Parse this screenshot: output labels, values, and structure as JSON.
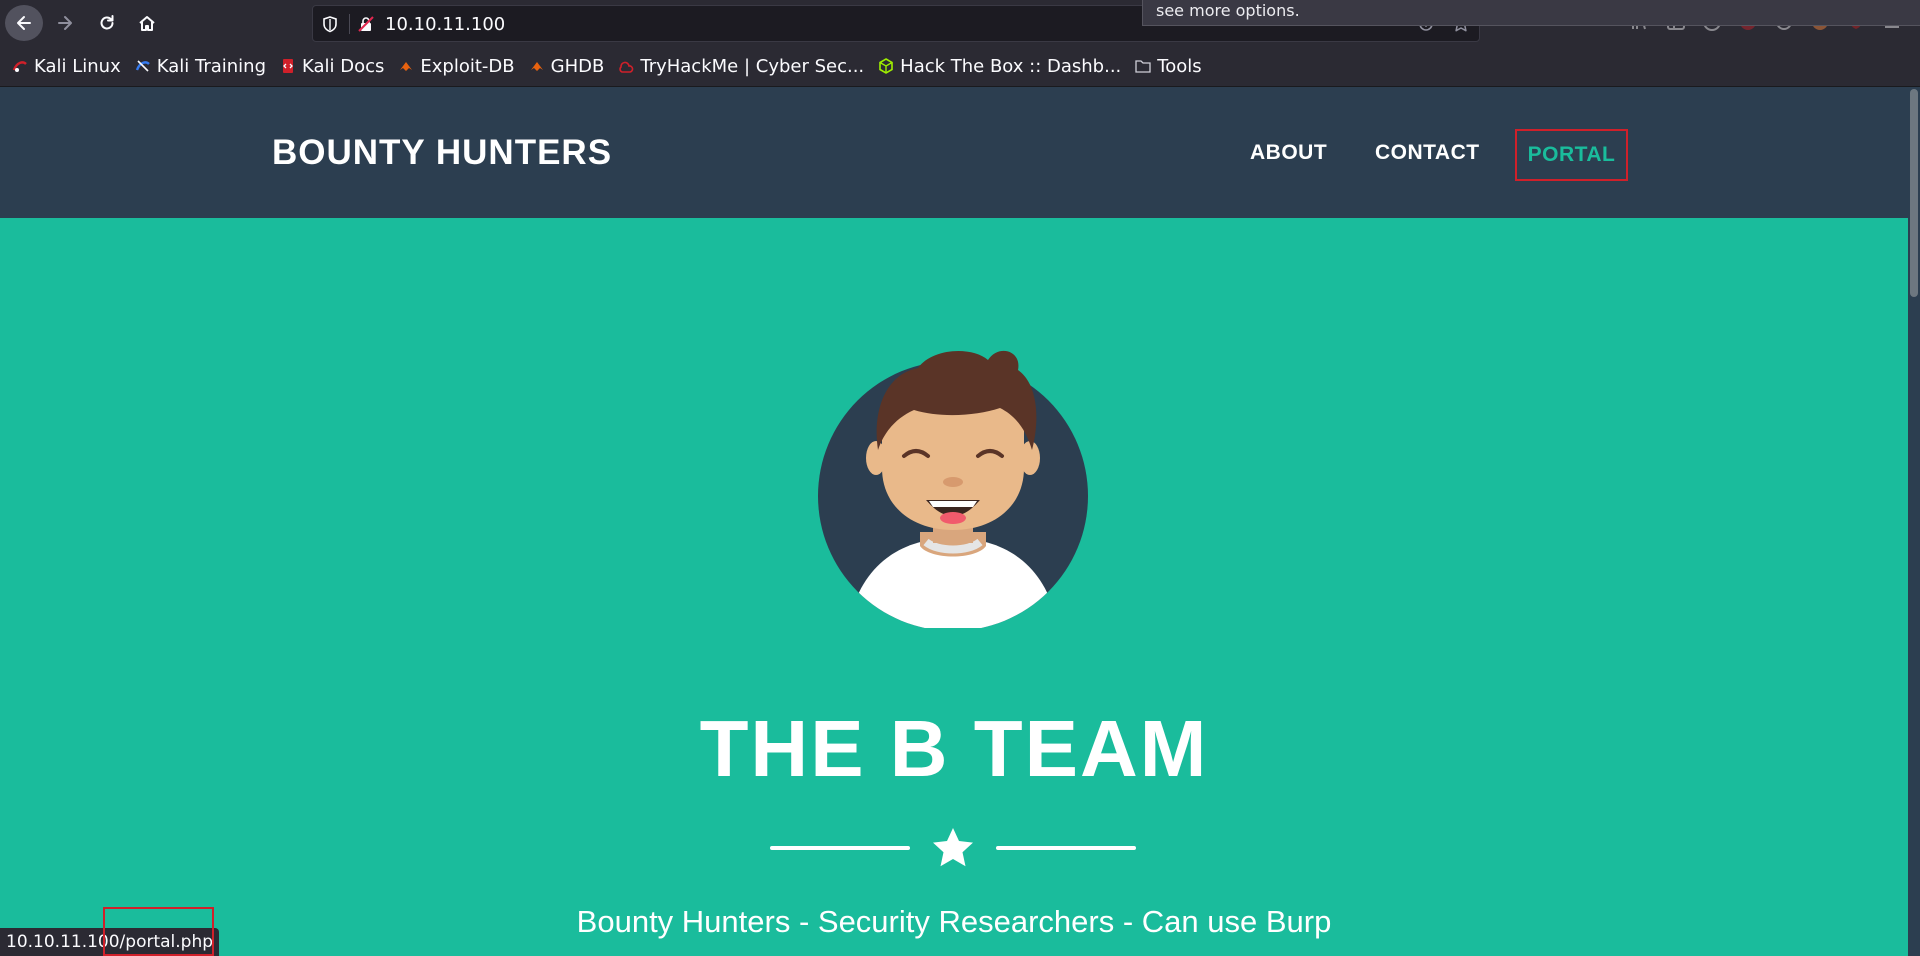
{
  "browser": {
    "url": "10.10.11.100",
    "tooltip": "see more options.",
    "status_url": "10.10.11.100/portal.php",
    "page_actions": "···",
    "bookmarks": [
      {
        "label": "Kali Linux",
        "icon": "kali-icon",
        "color": "#d0202a"
      },
      {
        "label": "Kali Training",
        "icon": "kali-training-icon",
        "color": "#367bf0"
      },
      {
        "label": "Kali Docs",
        "icon": "kali-docs-icon",
        "color": "#d0202a"
      },
      {
        "label": "Exploit-DB",
        "icon": "exploit-db-icon",
        "color": "#e8620f"
      },
      {
        "label": "GHDB",
        "icon": "ghdb-icon",
        "color": "#e8620f"
      },
      {
        "label": "TryHackMe | Cyber Sec...",
        "icon": "tryhackme-icon",
        "color": "#d0202a"
      },
      {
        "label": "Hack The Box :: Dashb...",
        "icon": "hackthebox-icon",
        "color": "#9fef00"
      },
      {
        "label": "Tools",
        "icon": "folder-icon",
        "color": "#cfcfd8"
      }
    ]
  },
  "site": {
    "brand": "BOUNTY HUNTERS",
    "nav": {
      "about": "ABOUT",
      "contact": "CONTACT",
      "portal": "PORTAL"
    },
    "hero": {
      "title": "THE B TEAM",
      "tagline": "Bounty Hunters - Security Researchers - Can use Burp"
    }
  },
  "colors": {
    "nav_bg": "#2c3e50",
    "hero_bg": "#1abc9c",
    "highlight": "#d0202a"
  }
}
